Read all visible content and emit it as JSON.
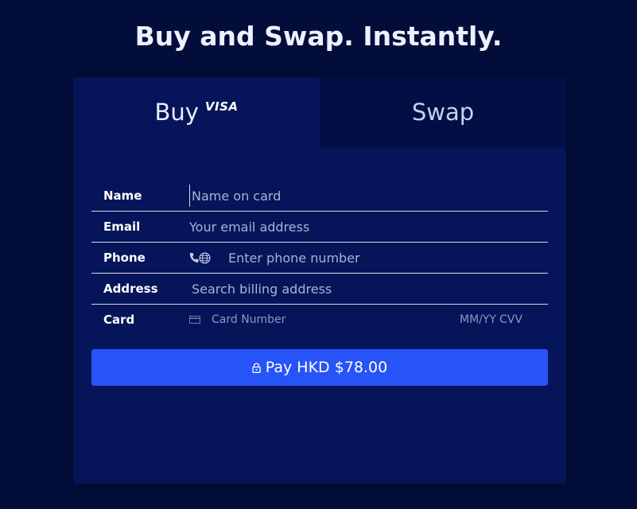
{
  "header": {
    "title": "Buy and Swap. Instantly."
  },
  "tabs": {
    "buy": {
      "label": "Buy",
      "badge": "VISA"
    },
    "swap": {
      "label": "Swap"
    }
  },
  "form": {
    "name": {
      "label": "Name",
      "placeholder": "Name on card"
    },
    "email": {
      "label": "Email",
      "placeholder": "Your email address"
    },
    "phone": {
      "label": "Phone",
      "placeholder": "Enter phone number"
    },
    "address": {
      "label": "Address",
      "placeholder": "Search billing address"
    },
    "card": {
      "label": "Card",
      "number_placeholder": "Card Number",
      "expiry_placeholder": "MM/YY",
      "cvv_placeholder": "CVV"
    }
  },
  "pay_button": {
    "label": "Pay HKD $78.00",
    "icon": "lock-icon"
  },
  "colors": {
    "background": "#020d3a",
    "card": "#061459",
    "inactive_tab": "#020f45",
    "accent": "#2654f7"
  },
  "icons": [
    "phone-icon",
    "globe-icon",
    "credit-card-icon",
    "lock-icon"
  ]
}
